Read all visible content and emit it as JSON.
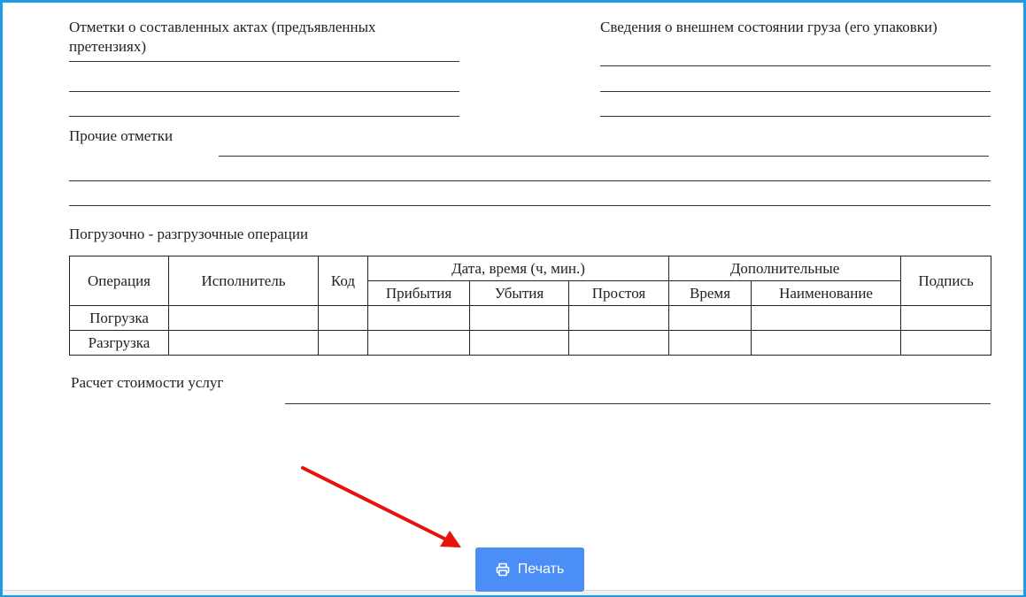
{
  "form": {
    "acts_label_line1": "Отметки о составленных актах (предъявленных",
    "acts_label_line2": "претензиях)",
    "cargo_label": "Сведения о внешнем состоянии груза (его упаковки)",
    "other_label": "Прочие отметки",
    "ops_label": "Погрузочно - разгрузочные операции",
    "cost_label": "Расчет стоимости услуг"
  },
  "table": {
    "headers": {
      "operation": "Операция",
      "executor": "Исполнитель",
      "code": "Код",
      "datetime": "Дата, время (ч, мин.)",
      "arrival": "Прибытия",
      "departure": "Убытия",
      "idle": "Простоя",
      "additional": "Дополнительные",
      "time": "Время",
      "name": "Наименование",
      "signature": "Подпись"
    },
    "rows": [
      {
        "operation": "Погрузка"
      },
      {
        "operation": "Разгрузка"
      }
    ]
  },
  "actions": {
    "print_label": "Печать",
    "print_icon": "printer-icon"
  },
  "colors": {
    "frame": "#1e9be6",
    "button": "#4b8ef5",
    "annotation_arrow": "#e8120c"
  }
}
